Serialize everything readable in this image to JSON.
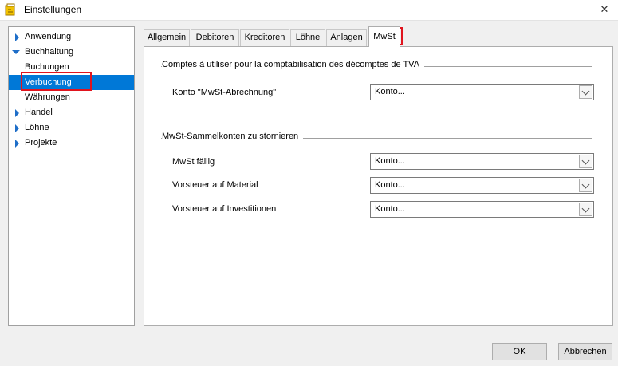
{
  "window": {
    "title": "Einstellungen",
    "close_glyph": "✕"
  },
  "nav": {
    "items": [
      {
        "label": "Anwendung",
        "icon": "chevron-right-icon"
      },
      {
        "label": "Buchhaltung",
        "icon": "chevron-down-icon"
      },
      {
        "label": "Buchungen"
      },
      {
        "label": "Verbuchung",
        "selected": true
      },
      {
        "label": "Währungen"
      },
      {
        "label": "Handel",
        "icon": "chevron-right-icon"
      },
      {
        "label": "Löhne",
        "icon": "chevron-right-icon"
      },
      {
        "label": "Projekte",
        "icon": "chevron-right-icon"
      }
    ]
  },
  "tabs": [
    {
      "label": "Allgemein"
    },
    {
      "label": "Debitoren"
    },
    {
      "label": "Kreditoren"
    },
    {
      "label": "Löhne"
    },
    {
      "label": "Anlagen"
    },
    {
      "label": "MwSt",
      "active": true
    }
  ],
  "mwst": {
    "group1": {
      "title": "Comptes à utiliser pour la comptabilisation des décomptes de TVA",
      "fields": [
        {
          "label": "Konto \"MwSt-Abrechnung\"",
          "value": "Konto..."
        }
      ]
    },
    "group2": {
      "title": "MwSt-Sammelkonten zu stornieren",
      "fields": [
        {
          "label": "MwSt fällig",
          "value": "Konto..."
        },
        {
          "label": "Vorsteuer auf Material",
          "value": "Konto..."
        },
        {
          "label": "Vorsteuer auf Investitionen",
          "value": "Konto..."
        }
      ]
    }
  },
  "buttons": {
    "ok": "OK",
    "cancel": "Abbrechen"
  },
  "colors": {
    "selection": "#0078d7",
    "highlight": "#e0141e",
    "tree_arrow": "#1e6ec8"
  }
}
